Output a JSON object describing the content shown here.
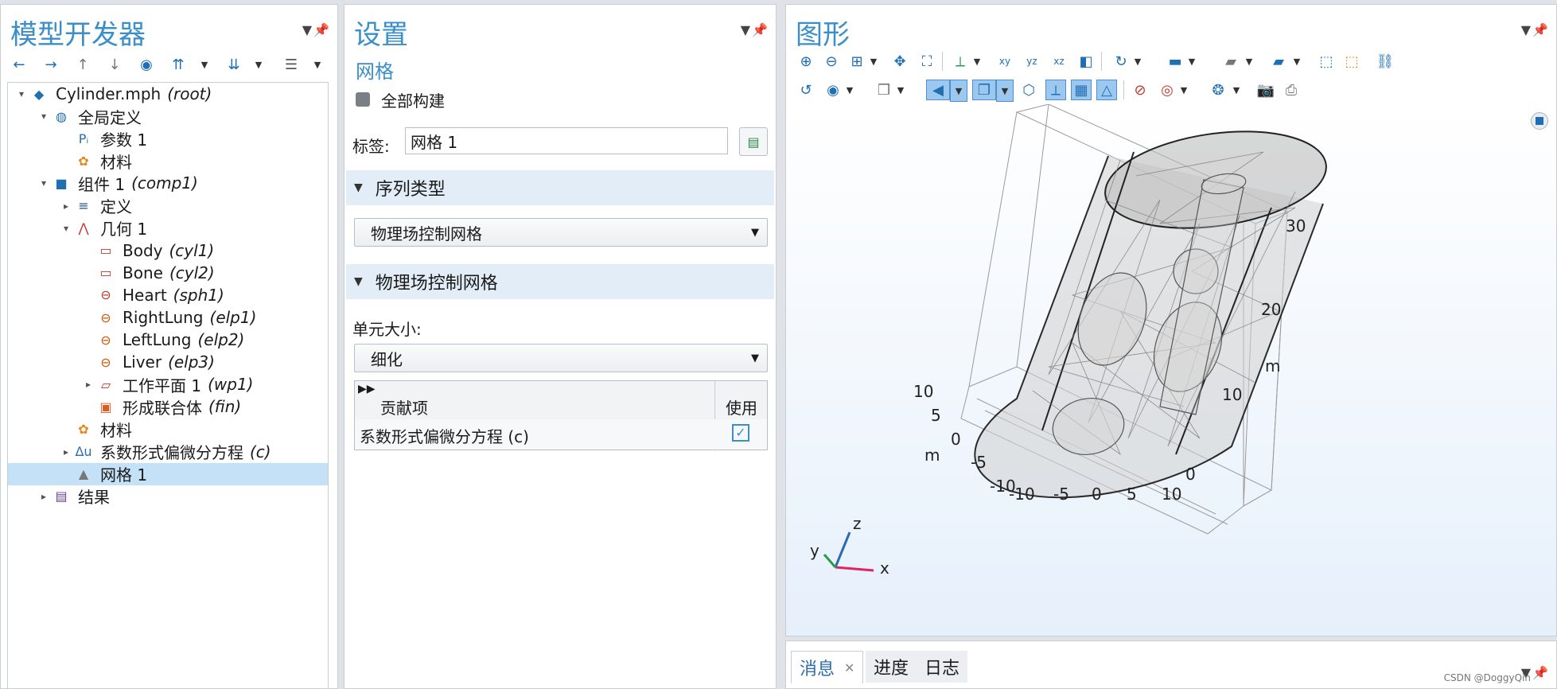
{
  "model_builder": {
    "title": "模型开发器",
    "tree": [
      {
        "label": "Cylinder.mph",
        "tag": "(root)",
        "exp": "▾",
        "icon": "model-icon",
        "glyph": "◆",
        "color": "#1f6fb3"
      },
      {
        "label": "全局定义",
        "tag": "",
        "exp": "▾",
        "icon": "globe-icon",
        "glyph": "◍",
        "color": "#1f6fb3"
      },
      {
        "label": "参数 1",
        "tag": "",
        "exp": "",
        "icon": "parameters-icon",
        "glyph": "Pᵢ",
        "color": "#2b6cb0"
      },
      {
        "label": "材料",
        "tag": "",
        "exp": "",
        "icon": "materials-icon",
        "glyph": "✿",
        "color": "#e28a1c"
      },
      {
        "label": "组件 1",
        "tag": "(comp1)",
        "exp": "▾",
        "icon": "component-icon",
        "glyph": "■",
        "color": "#1f6fb3"
      },
      {
        "label": "定义",
        "tag": "",
        "exp": "▸",
        "icon": "definitions-icon",
        "glyph": "≡",
        "color": "#1f4f8f"
      },
      {
        "label": "几何 1",
        "tag": "",
        "exp": "▾",
        "icon": "geometry-icon",
        "glyph": "⋀",
        "color": "#c0392b"
      },
      {
        "label": "Body",
        "tag": "(cyl1)",
        "exp": "",
        "icon": "cylinder-icon",
        "glyph": "▭",
        "color": "#c0392b"
      },
      {
        "label": "Bone",
        "tag": "(cyl2)",
        "exp": "",
        "icon": "cylinder-icon",
        "glyph": "▭",
        "color": "#c0392b"
      },
      {
        "label": "Heart",
        "tag": "(sph1)",
        "exp": "",
        "icon": "sphere-icon",
        "glyph": "⊖",
        "color": "#c0392b"
      },
      {
        "label": "RightLung",
        "tag": "(elp1)",
        "exp": "",
        "icon": "ellipsoid-icon",
        "glyph": "⊖",
        "color": "#d35400"
      },
      {
        "label": "LeftLung",
        "tag": "(elp2)",
        "exp": "",
        "icon": "ellipsoid-icon",
        "glyph": "⊖",
        "color": "#d35400"
      },
      {
        "label": "Liver",
        "tag": "(elp3)",
        "exp": "",
        "icon": "ellipsoid-icon",
        "glyph": "⊖",
        "color": "#d35400"
      },
      {
        "label": "工作平面 1",
        "tag": "(wp1)",
        "exp": "▸",
        "icon": "work-plane-icon",
        "glyph": "▱",
        "color": "#c0392b"
      },
      {
        "label": "形成联合体",
        "tag": "(fin)",
        "exp": "",
        "icon": "form-union-icon",
        "glyph": "▣",
        "color": "#e05a1c"
      },
      {
        "label": "材料",
        "tag": "",
        "exp": "",
        "icon": "materials-icon",
        "glyph": "✿",
        "color": "#e28a1c"
      },
      {
        "label": "系数形式偏微分方程",
        "tag": "(c)",
        "exp": "▸",
        "icon": "pde-icon",
        "glyph": "Δu",
        "color": "#2b6cb0"
      },
      {
        "label": "网格 1",
        "tag": "",
        "exp": "",
        "icon": "mesh-icon",
        "glyph": "▲",
        "color": "#777777"
      },
      {
        "label": "结果",
        "tag": "",
        "exp": "▸",
        "icon": "results-icon",
        "glyph": "▤",
        "color": "#6a3f9e"
      }
    ]
  },
  "settings": {
    "title": "设置",
    "subtitle": "网格",
    "build_all": "全部构建",
    "label_caption": "标签:",
    "label_value": "网格 1",
    "sequence_section": "序列类型",
    "sequence_value": "物理场控制网格",
    "physics_section": "物理场控制网格",
    "element_size_caption": "单元大小:",
    "element_size_value": "细化",
    "table_headers": [
      "贡献项",
      "使用"
    ],
    "table_row": "系数形式偏微分方程 (c)"
  },
  "graphics": {
    "title": "图形",
    "axis_unit": "m",
    "z_ticks": [
      "30",
      "20",
      "10"
    ],
    "y_ticks": [
      "10",
      "5",
      "0",
      "-5",
      "-10"
    ],
    "x_ticks": [
      "-10",
      "-5",
      "0",
      "5",
      "10"
    ],
    "zero_label": "0",
    "triad": {
      "x": "x",
      "y": "y",
      "z": "z"
    },
    "watermark": "CSDN @DoggyQin"
  },
  "messages": {
    "tabs": [
      "消息",
      "进度",
      "日志"
    ],
    "close_glyph": "✕"
  },
  "colors": {
    "accent": "#3a8ec9",
    "selection": "#c5e1f8",
    "section_bar": "#e3edf7"
  }
}
